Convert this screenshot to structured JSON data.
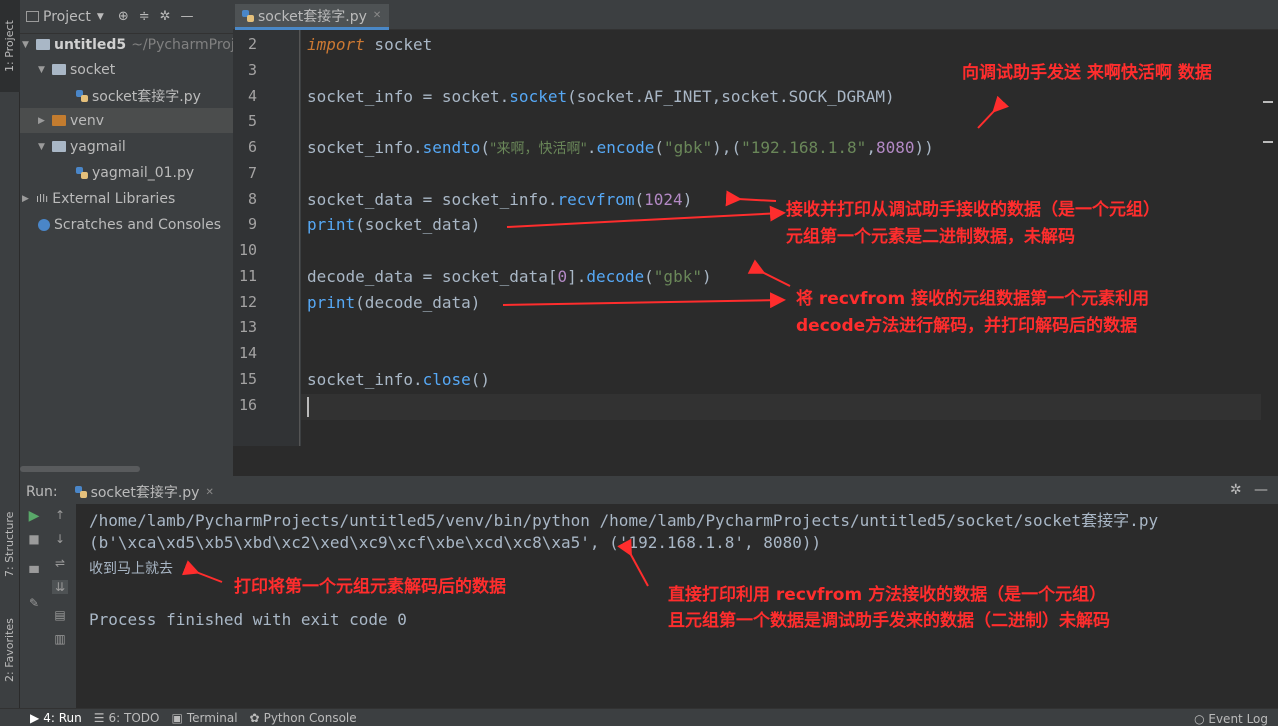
{
  "sidebar": {
    "project_tab": "1: Project",
    "structure_tab": "7: Structure",
    "favorites_tab": "2: Favorites"
  },
  "project_panel": {
    "title": "Project",
    "tree": [
      {
        "label": "untitled5",
        "suffix": "~/PycharmProje"
      },
      {
        "label": "socket"
      },
      {
        "label": "socket套接字.py"
      },
      {
        "label": "venv"
      },
      {
        "label": "yagmail"
      },
      {
        "label": "yagmail_01.py"
      },
      {
        "label": "External Libraries"
      },
      {
        "label": "Scratches and Consoles"
      }
    ]
  },
  "editor": {
    "tab_label": "socket套接字.py",
    "line_numbers": [
      "2",
      "3",
      "4",
      "5",
      "6",
      "7",
      "8",
      "9",
      "10",
      "11",
      "12",
      "13",
      "14",
      "15",
      "16"
    ],
    "code": {
      "l2_kw": "import",
      "l2_rest": " socket",
      "l4_a": "socket_info = socket.",
      "l4_fn": "socket",
      "l4_b": "(socket.AF_INET,socket.SOCK_DGRAM)",
      "l6_a": "socket_info.",
      "l6_fn": "sendto",
      "l6_b": "(",
      "l6_s1": "\"来啊，快活啊\"",
      "l6_c": ".",
      "l6_fn2": "encode",
      "l6_d": "(",
      "l6_s2": "\"gbk\"",
      "l6_e": "),(",
      "l6_s3": "\"192.168.1.8\"",
      "l6_f": ",",
      "l6_num": "8080",
      "l6_g": "))",
      "l8_a": "socket_data = socket_info.",
      "l8_fn": "recvfrom",
      "l8_b": "(",
      "l8_num": "1024",
      "l8_c": ")",
      "l9_fn": "print",
      "l9_rest": "(socket_data)",
      "l11_a": "decode_data = socket_data[",
      "l11_num": "0",
      "l11_b": "].",
      "l11_fn": "decode",
      "l11_c": "(",
      "l11_s": "\"gbk\"",
      "l11_d": ")",
      "l12_fn": "print",
      "l12_rest": "(decode_data)",
      "l15_a": "socket_info.",
      "l15_fn": "close",
      "l15_b": "()"
    }
  },
  "run_panel": {
    "label": "Run:",
    "tab": "socket套接字.py",
    "output": [
      "/home/lamb/PycharmProjects/untitled5/venv/bin/python /home/lamb/PycharmProjects/untitled5/socket/socket套接字.py",
      "(b'\\xca\\xd5\\xb5\\xbd\\xc2\\xed\\xc9\\xcf\\xbe\\xcd\\xc8\\xa5', ('192.168.1.8', 8080))",
      "收到马上就去",
      "Process finished with exit code 0"
    ]
  },
  "bottom_bar": {
    "run": "4: Run",
    "todo": "6: TODO",
    "terminal": "Terminal",
    "python_console": "Python Console",
    "event_log": "Event Log"
  },
  "annotations": {
    "a1": "向调试助手发送 来啊快活啊 数据",
    "a2": "接收并打印从调试助手接收的数据（是一个元组）",
    "a3": "元组第一个元素是二进制数据，未解码",
    "a4": "将 recvfrom 接收的元组数据第一个元素利用",
    "a5": "decode方法进行解码，并打印解码后的数据",
    "a6": "打印将第一个元组元素解码后的数据",
    "a7": "直接打印利用 recvfrom 方法接收的数据（是一个元组）",
    "a8": "且元组第一个数据是调试助手发来的数据（二进制）未解码"
  },
  "colors": {
    "annotation": "#ff2d2d",
    "keyword": "#cc7832",
    "string": "#6a8759",
    "number": "#6897bb",
    "method": "#56a8f5"
  }
}
